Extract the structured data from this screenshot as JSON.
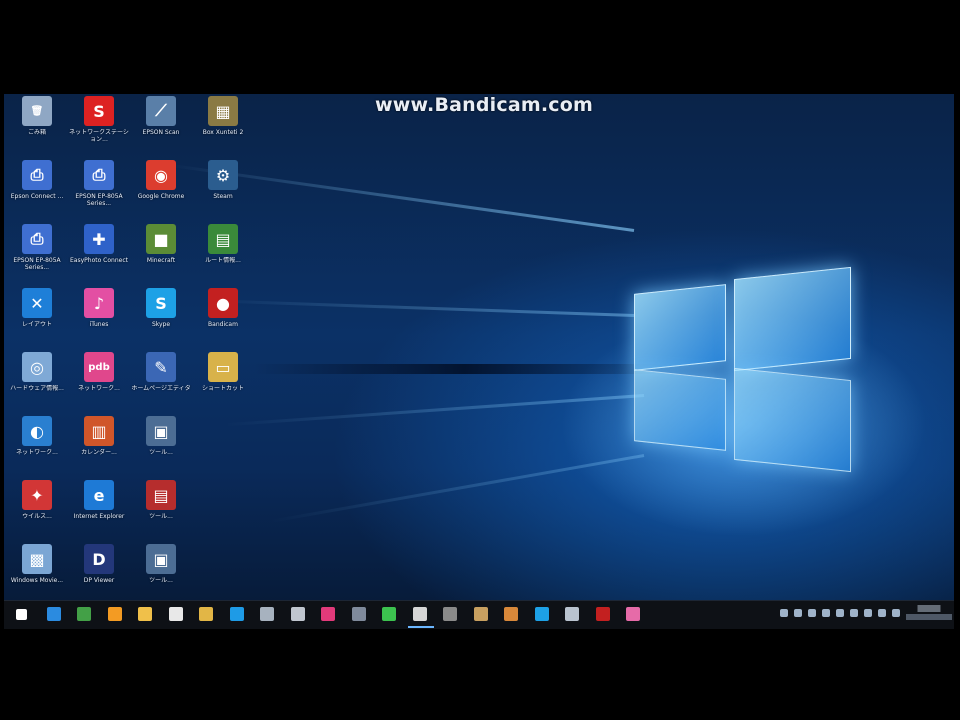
{
  "watermark": "www.Bandicam.com",
  "desktop": {
    "icons": [
      {
        "name": "recycle-bin-icon",
        "label": "ごみ箱",
        "color": "#8fa7c4",
        "symbol": "🗑"
      },
      {
        "name": "app-shortcut-icon",
        "label": "ネットワークステーション...",
        "color": "#d22",
        "symbol": "S"
      },
      {
        "name": "epson-scan-icon",
        "label": "EPSON Scan",
        "color": "#5a7fa8",
        "symbol": "⟋"
      },
      {
        "name": "box-icon",
        "label": "Box Xunteti 2",
        "color": "#8a7a44",
        "symbol": "▦"
      },
      {
        "name": "epson-connect-icon",
        "label": "Epson Connect ...",
        "color": "#3f6fd1",
        "symbol": "⎙"
      },
      {
        "name": "epson-printer-icon",
        "label": "EPSON EP-805A Series...",
        "color": "#3f6fd1",
        "symbol": "⎙"
      },
      {
        "name": "google-chrome-icon",
        "label": "Google Chrome",
        "color": "#dc3d2f",
        "symbol": "◉"
      },
      {
        "name": "steam-icon",
        "label": "Steam",
        "color": "#2b5d8f",
        "symbol": "⚙"
      },
      {
        "name": "epson-series-icon",
        "label": "EPSON EP-805A Series...",
        "color": "#3f6fd1",
        "symbol": "⎙"
      },
      {
        "name": "epson-connect-2-icon",
        "label": "EasyPhoto Connect",
        "color": "#2f62c9",
        "symbol": "✚"
      },
      {
        "name": "minecraft-icon",
        "label": "Minecraft",
        "color": "#5b8c36",
        "symbol": "■"
      },
      {
        "name": "app-green-icon",
        "label": "ルート情報...",
        "color": "#3a8a3a",
        "symbol": "▤"
      },
      {
        "name": "xmind-icon",
        "label": "レイアウト",
        "color": "#1e7fd8",
        "symbol": "✕"
      },
      {
        "name": "itunes-icon",
        "label": "iTunes",
        "color": "#e34fa3",
        "symbol": "♪"
      },
      {
        "name": "skype-icon",
        "label": "Skype",
        "color": "#1da1e6",
        "symbol": "S"
      },
      {
        "name": "bandicam-icon",
        "label": "Bandicam",
        "color": "#c32020",
        "symbol": "●"
      },
      {
        "name": "desktop-app-icon",
        "label": "ハードウェア情報...",
        "color": "#7fa9d6",
        "symbol": "◎"
      },
      {
        "name": "pdb-app-icon",
        "label": "ネットワーク...",
        "color": "#e0478c",
        "symbol": "pdb"
      },
      {
        "name": "editor-app-icon",
        "label": "ホームページエディタ",
        "color": "#3b67b5",
        "symbol": "✎"
      },
      {
        "name": "folder-icon",
        "label": "ショートカット",
        "color": "#d8b24a",
        "symbol": "▭"
      },
      {
        "name": "network-icon",
        "label": "ネットワーク...",
        "color": "#2a7fd0",
        "symbol": "◐"
      },
      {
        "name": "calendar-icon",
        "label": "カレンダー...",
        "color": "#d0562a",
        "symbol": "▥"
      },
      {
        "name": "settings-tool-icon",
        "label": "ツール...",
        "color": "#4c6d94",
        "symbol": "▣"
      },
      {
        "name": "blank-slot",
        "label": "",
        "color": "rgba(0,0,0,0)",
        "symbol": ""
      },
      {
        "name": "red-app-icon",
        "label": "ウイルス...",
        "color": "#d23636",
        "symbol": "✦"
      },
      {
        "name": "internet-explorer-icon",
        "label": "Internet Explorer",
        "color": "#1e7ad6",
        "symbol": "e"
      },
      {
        "name": "red-shortcut-icon",
        "label": "ツール...",
        "color": "#b62d2d",
        "symbol": "▤"
      },
      {
        "name": "blank-slot-2",
        "label": "",
        "color": "rgba(0,0,0,0)",
        "symbol": ""
      },
      {
        "name": "media-icon",
        "label": "Windows Movie...",
        "color": "#7ba6d4",
        "symbol": "▩"
      },
      {
        "name": "d-app-icon",
        "label": "DP Viewer",
        "color": "#23377a",
        "symbol": "D"
      },
      {
        "name": "tool-shortcut-icon",
        "label": "ツール...",
        "color": "#4c6d94",
        "symbol": "▣"
      }
    ]
  },
  "taskbar": {
    "items": [
      {
        "name": "start-button-icon",
        "color": "#ffffff"
      },
      {
        "name": "edge-icon",
        "color": "#2b8be0"
      },
      {
        "name": "chrome-taskbar-icon",
        "color": "#43a047"
      },
      {
        "name": "firefox-taskbar-icon",
        "color": "#f39b23"
      },
      {
        "name": "file-explorer-icon",
        "color": "#f0c04a"
      },
      {
        "name": "store-icon",
        "color": "#e8e8e8"
      },
      {
        "name": "folder-taskbar-icon",
        "color": "#e2b646"
      },
      {
        "name": "xmind-taskbar-icon",
        "color": "#1e9be6"
      },
      {
        "name": "app-taskbar-icon-1",
        "color": "#a7b2bf"
      },
      {
        "name": "app-taskbar-icon-2",
        "color": "#c0c6cf"
      },
      {
        "name": "app-taskbar-icon-3",
        "color": "#e23a7a"
      },
      {
        "name": "app-taskbar-icon-4",
        "color": "#7f8a9b"
      },
      {
        "name": "line-icon",
        "color": "#3cc24f"
      },
      {
        "name": "app-taskbar-icon-5",
        "color": "#d6d6d6"
      },
      {
        "name": "app-taskbar-icon-6",
        "color": "#8a8a8a"
      },
      {
        "name": "app-taskbar-icon-7",
        "color": "#c8a060"
      },
      {
        "name": "app-taskbar-icon-8",
        "color": "#d8883a"
      },
      {
        "name": "skype-taskbar-icon",
        "color": "#1da1e6"
      },
      {
        "name": "app-taskbar-icon-9",
        "color": "#b9c3cf"
      },
      {
        "name": "bandicam-taskbar-icon",
        "color": "#c32020"
      },
      {
        "name": "pink-app-taskbar-icon",
        "color": "#e66ba8"
      }
    ],
    "tray_icons": [
      "tray-chevron-icon",
      "tray-network-icon",
      "tray-app-icon",
      "tray-line-icon",
      "tray-app-2-icon",
      "tray-app-3-icon",
      "tray-volume-icon",
      "tray-ime-icon",
      "tray-notification-icon"
    ]
  }
}
